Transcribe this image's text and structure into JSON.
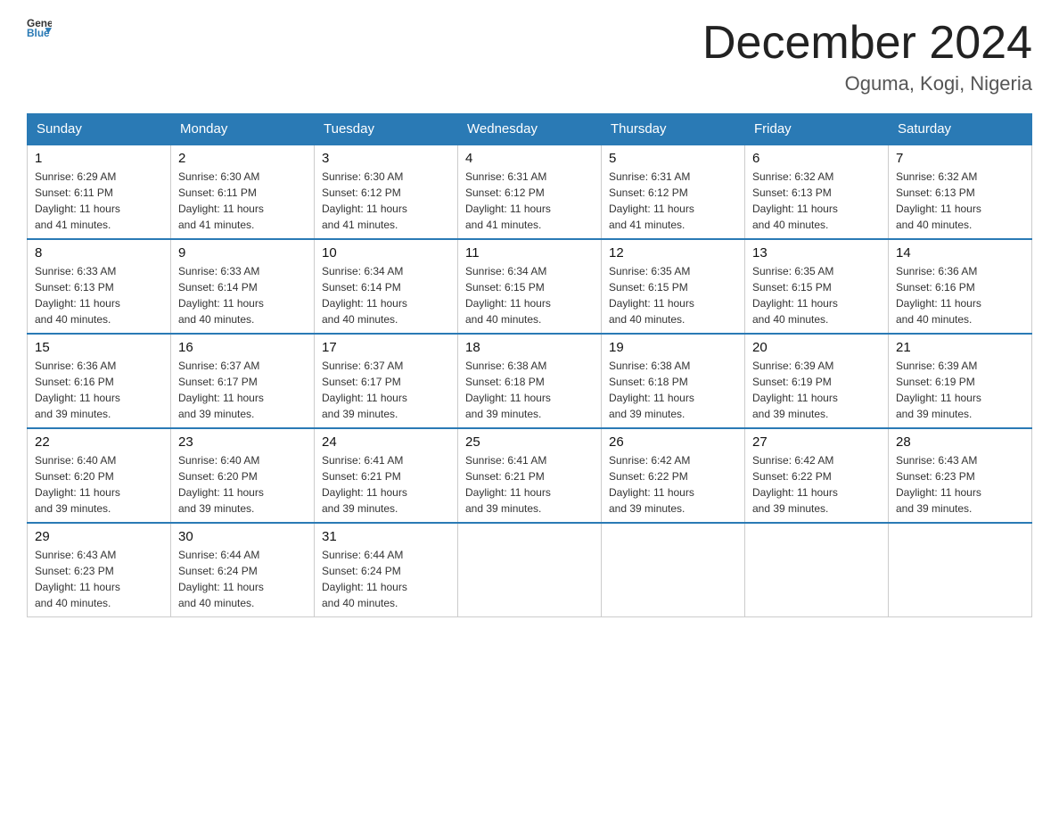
{
  "header": {
    "logo_general": "General",
    "logo_blue": "Blue",
    "month_title": "December 2024",
    "location": "Oguma, Kogi, Nigeria"
  },
  "days_of_week": [
    "Sunday",
    "Monday",
    "Tuesday",
    "Wednesday",
    "Thursday",
    "Friday",
    "Saturday"
  ],
  "weeks": [
    [
      {
        "day": "1",
        "sunrise": "6:29 AM",
        "sunset": "6:11 PM",
        "daylight": "11 hours and 41 minutes."
      },
      {
        "day": "2",
        "sunrise": "6:30 AM",
        "sunset": "6:11 PM",
        "daylight": "11 hours and 41 minutes."
      },
      {
        "day": "3",
        "sunrise": "6:30 AM",
        "sunset": "6:12 PM",
        "daylight": "11 hours and 41 minutes."
      },
      {
        "day": "4",
        "sunrise": "6:31 AM",
        "sunset": "6:12 PM",
        "daylight": "11 hours and 41 minutes."
      },
      {
        "day": "5",
        "sunrise": "6:31 AM",
        "sunset": "6:12 PM",
        "daylight": "11 hours and 41 minutes."
      },
      {
        "day": "6",
        "sunrise": "6:32 AM",
        "sunset": "6:13 PM",
        "daylight": "11 hours and 40 minutes."
      },
      {
        "day": "7",
        "sunrise": "6:32 AM",
        "sunset": "6:13 PM",
        "daylight": "11 hours and 40 minutes."
      }
    ],
    [
      {
        "day": "8",
        "sunrise": "6:33 AM",
        "sunset": "6:13 PM",
        "daylight": "11 hours and 40 minutes."
      },
      {
        "day": "9",
        "sunrise": "6:33 AM",
        "sunset": "6:14 PM",
        "daylight": "11 hours and 40 minutes."
      },
      {
        "day": "10",
        "sunrise": "6:34 AM",
        "sunset": "6:14 PM",
        "daylight": "11 hours and 40 minutes."
      },
      {
        "day": "11",
        "sunrise": "6:34 AM",
        "sunset": "6:15 PM",
        "daylight": "11 hours and 40 minutes."
      },
      {
        "day": "12",
        "sunrise": "6:35 AM",
        "sunset": "6:15 PM",
        "daylight": "11 hours and 40 minutes."
      },
      {
        "day": "13",
        "sunrise": "6:35 AM",
        "sunset": "6:15 PM",
        "daylight": "11 hours and 40 minutes."
      },
      {
        "day": "14",
        "sunrise": "6:36 AM",
        "sunset": "6:16 PM",
        "daylight": "11 hours and 40 minutes."
      }
    ],
    [
      {
        "day": "15",
        "sunrise": "6:36 AM",
        "sunset": "6:16 PM",
        "daylight": "11 hours and 39 minutes."
      },
      {
        "day": "16",
        "sunrise": "6:37 AM",
        "sunset": "6:17 PM",
        "daylight": "11 hours and 39 minutes."
      },
      {
        "day": "17",
        "sunrise": "6:37 AM",
        "sunset": "6:17 PM",
        "daylight": "11 hours and 39 minutes."
      },
      {
        "day": "18",
        "sunrise": "6:38 AM",
        "sunset": "6:18 PM",
        "daylight": "11 hours and 39 minutes."
      },
      {
        "day": "19",
        "sunrise": "6:38 AM",
        "sunset": "6:18 PM",
        "daylight": "11 hours and 39 minutes."
      },
      {
        "day": "20",
        "sunrise": "6:39 AM",
        "sunset": "6:19 PM",
        "daylight": "11 hours and 39 minutes."
      },
      {
        "day": "21",
        "sunrise": "6:39 AM",
        "sunset": "6:19 PM",
        "daylight": "11 hours and 39 minutes."
      }
    ],
    [
      {
        "day": "22",
        "sunrise": "6:40 AM",
        "sunset": "6:20 PM",
        "daylight": "11 hours and 39 minutes."
      },
      {
        "day": "23",
        "sunrise": "6:40 AM",
        "sunset": "6:20 PM",
        "daylight": "11 hours and 39 minutes."
      },
      {
        "day": "24",
        "sunrise": "6:41 AM",
        "sunset": "6:21 PM",
        "daylight": "11 hours and 39 minutes."
      },
      {
        "day": "25",
        "sunrise": "6:41 AM",
        "sunset": "6:21 PM",
        "daylight": "11 hours and 39 minutes."
      },
      {
        "day": "26",
        "sunrise": "6:42 AM",
        "sunset": "6:22 PM",
        "daylight": "11 hours and 39 minutes."
      },
      {
        "day": "27",
        "sunrise": "6:42 AM",
        "sunset": "6:22 PM",
        "daylight": "11 hours and 39 minutes."
      },
      {
        "day": "28",
        "sunrise": "6:43 AM",
        "sunset": "6:23 PM",
        "daylight": "11 hours and 39 minutes."
      }
    ],
    [
      {
        "day": "29",
        "sunrise": "6:43 AM",
        "sunset": "6:23 PM",
        "daylight": "11 hours and 40 minutes."
      },
      {
        "day": "30",
        "sunrise": "6:44 AM",
        "sunset": "6:24 PM",
        "daylight": "11 hours and 40 minutes."
      },
      {
        "day": "31",
        "sunrise": "6:44 AM",
        "sunset": "6:24 PM",
        "daylight": "11 hours and 40 minutes."
      },
      null,
      null,
      null,
      null
    ]
  ],
  "labels": {
    "sunrise": "Sunrise:",
    "sunset": "Sunset:",
    "daylight": "Daylight:"
  }
}
